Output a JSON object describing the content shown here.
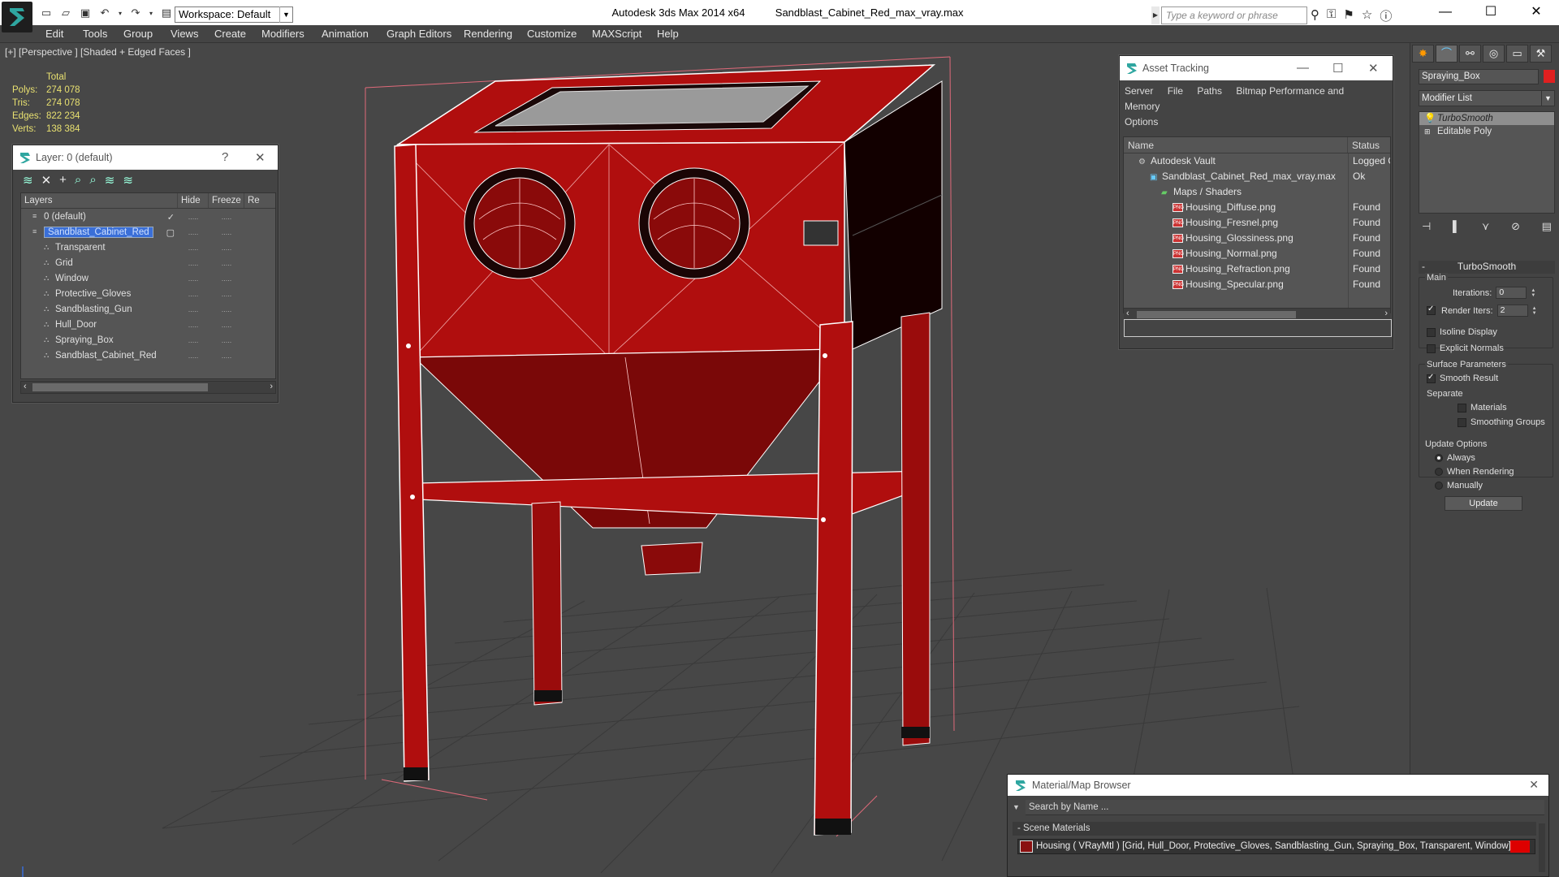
{
  "titlebar": {
    "app": "Autodesk 3ds Max  2014 x64",
    "file": "Sandblast_Cabinet_Red_max_vray.max",
    "workspace": "Workspace: Default",
    "search_placeholder": "Type a keyword or phrase"
  },
  "menu": [
    "Edit",
    "Tools",
    "Group",
    "Views",
    "Create",
    "Modifiers",
    "Animation",
    "Graph Editors",
    "Rendering",
    "Customize",
    "MAXScript",
    "Help"
  ],
  "viewport": {
    "label": "[+] [Perspective ] [Shaded + Edged Faces ]",
    "stats_header": "Total",
    "stats": [
      {
        "k": "Polys:",
        "v": "274 078"
      },
      {
        "k": "Tris:",
        "v": "274 078"
      },
      {
        "k": "Edges:",
        "v": "822 234"
      },
      {
        "k": "Verts:",
        "v": "138 384"
      }
    ]
  },
  "layer_window": {
    "title": "Layer: 0 (default)",
    "help": "?",
    "close": "✕",
    "columns": [
      "Layers",
      "Hide",
      "Freeze",
      "Re"
    ],
    "rows": [
      {
        "name": "0 (default)",
        "indent": 1
      },
      {
        "name": "Sandblast_Cabinet_Red",
        "indent": 1,
        "selected": true
      },
      {
        "name": "Transparent",
        "indent": 2
      },
      {
        "name": "Grid",
        "indent": 2
      },
      {
        "name": "Window",
        "indent": 2
      },
      {
        "name": "Protective_Gloves",
        "indent": 2
      },
      {
        "name": "Sandblasting_Gun",
        "indent": 2
      },
      {
        "name": "Hull_Door",
        "indent": 2
      },
      {
        "name": "Spraying_Box",
        "indent": 2
      },
      {
        "name": "Sandblast_Cabinet_Red",
        "indent": 2
      }
    ],
    "dash": "....."
  },
  "asset_window": {
    "title": "Asset Tracking",
    "menu": [
      "Server",
      "File",
      "Paths",
      "Bitmap Performance and Memory",
      "Options"
    ],
    "columns": [
      "Name",
      "Status"
    ],
    "rows": [
      {
        "name": "Autodesk Vault",
        "status": "Logged O",
        "indent": 1,
        "icon": "vault"
      },
      {
        "name": "Sandblast_Cabinet_Red_max_vray.max",
        "status": "Ok",
        "indent": 2,
        "icon": "max"
      },
      {
        "name": "Maps / Shaders",
        "status": "",
        "indent": 3,
        "icon": "maps"
      },
      {
        "name": "Housing_Diffuse.png",
        "status": "Found",
        "indent": 4,
        "icon": "png"
      },
      {
        "name": "Housing_Fresnel.png",
        "status": "Found",
        "indent": 4,
        "icon": "png"
      },
      {
        "name": "Housing_Glossiness.png",
        "status": "Found",
        "indent": 4,
        "icon": "png"
      },
      {
        "name": "Housing_Normal.png",
        "status": "Found",
        "indent": 4,
        "icon": "png"
      },
      {
        "name": "Housing_Refraction.png",
        "status": "Found",
        "indent": 4,
        "icon": "png"
      },
      {
        "name": "Housing_Specular.png",
        "status": "Found",
        "indent": 4,
        "icon": "png"
      }
    ]
  },
  "command_panel": {
    "object_name": "Spraying_Box",
    "object_color": "#e02020",
    "modifier_list": "Modifier List",
    "stack": [
      "TurboSmooth",
      "Editable Poly"
    ],
    "rollout_title": "TurboSmooth",
    "main_label": "Main",
    "iterations_label": "Iterations:",
    "iterations_value": "0",
    "render_iters_label": "Render Iters:",
    "render_iters_value": "2",
    "isoline": "Isoline Display",
    "explicit_normals": "Explicit Normals",
    "surface_params": "Surface Parameters",
    "smooth_result": "Smooth Result",
    "separate": "Separate",
    "materials": "Materials",
    "smoothing_groups": "Smoothing Groups",
    "update_options": "Update Options",
    "always": "Always",
    "when_rendering": "When Rendering",
    "manually": "Manually",
    "update_btn": "Update"
  },
  "material_browser": {
    "title": "Material/Map Browser",
    "search_placeholder": "Search by Name ...",
    "section": "- Scene Materials",
    "row": "Housing  ( VRayMtl ) [Grid, Hull_Door, Protective_Gloves, Sandblasting_Gun, Spraying_Box, Transparent, Window]"
  },
  "colors": {
    "accent": "#3a6fd8",
    "object_red": "#b00e0e",
    "stats": "#e8e070"
  }
}
